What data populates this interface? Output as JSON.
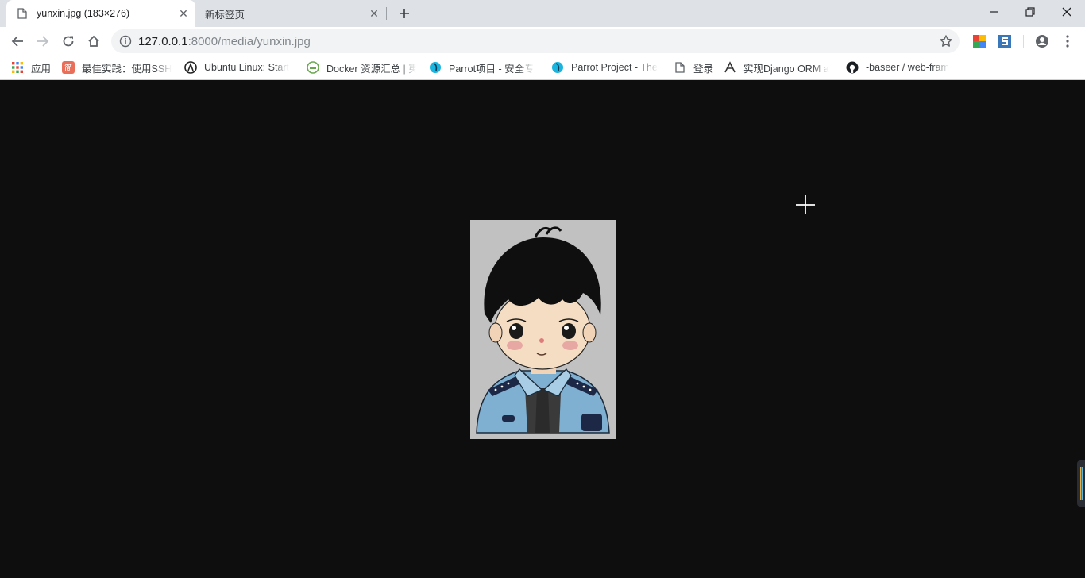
{
  "tabs": [
    {
      "title": "yunxin.jpg (183×276)",
      "active": true
    },
    {
      "title": "新标签页",
      "active": false
    }
  ],
  "toolbar": {
    "url_host": "127.0.0.1",
    "url_rest": ":8000/media/yunxin.jpg"
  },
  "bookmarks": [
    {
      "label": "应用",
      "icon": "apps-grid-icon"
    },
    {
      "label": "最佳实践：使用SSH",
      "icon": "jianshu-icon"
    },
    {
      "label": "Ubuntu Linux: Start",
      "icon": "ubuntu-icon"
    },
    {
      "label": "Docker 资源汇总 | 夷",
      "icon": "docker-icon"
    },
    {
      "label": "Parrot项目 - 安全专",
      "icon": "parrot-icon"
    },
    {
      "label": "Parrot Project - The",
      "icon": "parrot-icon"
    },
    {
      "label": "登录",
      "icon": "page-icon"
    },
    {
      "label": "实现Django ORM a",
      "icon": "orm-icon"
    },
    {
      "label": "-baseer / web-fram",
      "icon": "github-icon"
    }
  ],
  "colors": {
    "tabstrip": "#dee1e6",
    "viewport_bg": "#0e0e0e",
    "image_bg": "#c1c1c1"
  }
}
